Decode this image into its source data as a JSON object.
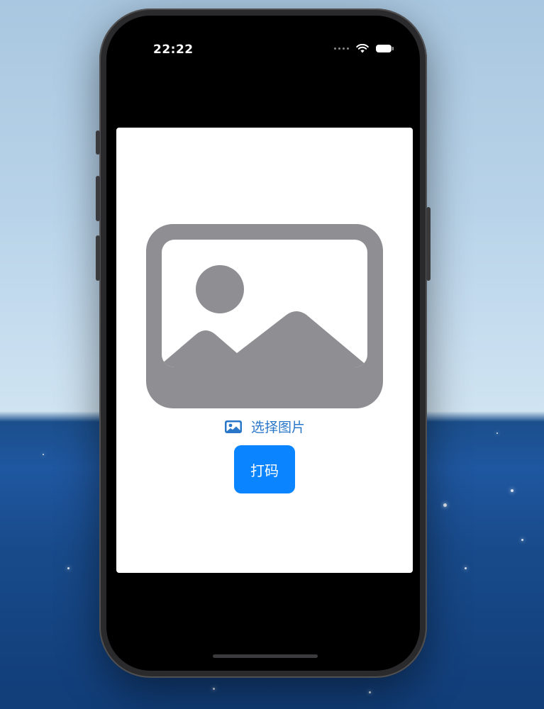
{
  "status_bar": {
    "time": "22:22",
    "wifi_icon": "wifi-icon",
    "battery_icon": "battery-icon"
  },
  "image_preview": {
    "icon": "photo-placeholder-icon"
  },
  "select_image": {
    "icon": "photo-icon",
    "label": "选择图片"
  },
  "code_button": {
    "label": "打码"
  },
  "colors": {
    "accent": "#0a84ff",
    "link": "#2a77c9",
    "placeholder_gray": "#8e8e93"
  }
}
